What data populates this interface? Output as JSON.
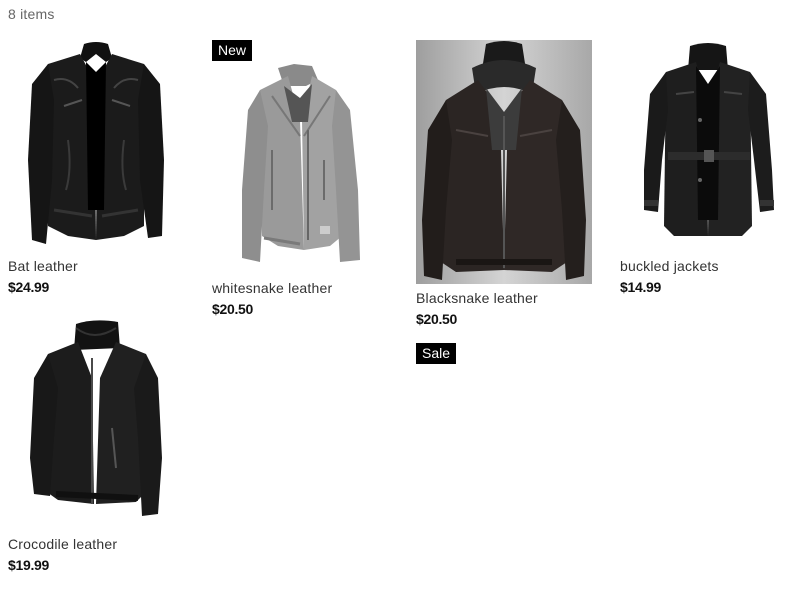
{
  "listing": {
    "item_count": "8 items"
  },
  "products": [
    {
      "name": "Bat leather",
      "price": "$24.99",
      "badge": "",
      "image": "black-leather-jacket"
    },
    {
      "name": "whitesnake leather",
      "price": "$20.50",
      "badge": "New",
      "image": "grey-biker-jacket"
    },
    {
      "name": "Blacksnake leather",
      "price": "$20.50",
      "badge": "Sale",
      "image": "dark-hooded-leather-jacket"
    },
    {
      "name": "buckled jackets",
      "price": "$14.99",
      "badge": "",
      "image": "black-belted-coat"
    },
    {
      "name": "Crocodile leather",
      "price": "$19.99",
      "badge": "",
      "image": "black-zip-jacket"
    }
  ],
  "colors": {
    "badge_bg": "#000000",
    "badge_text": "#ffffff",
    "photo_bg": "#b9b9b9"
  }
}
